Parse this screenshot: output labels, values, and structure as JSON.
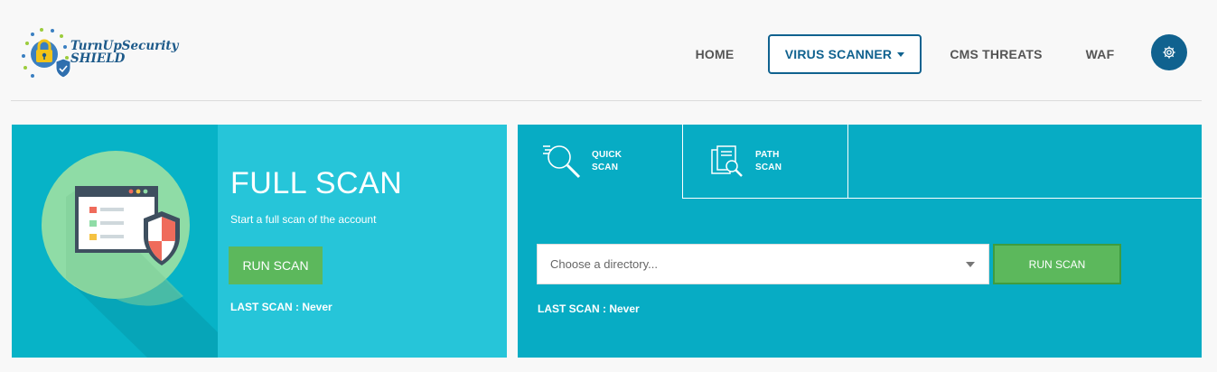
{
  "brand": {
    "line1": "TurnUpSecurity",
    "line2": "SHIELD"
  },
  "nav": {
    "home": "HOME",
    "virus_scanner": "VIRUS SCANNER",
    "cms_threats": "CMS THREATS",
    "waf": "WAF",
    "settings_icon": "gear-icon"
  },
  "full_scan": {
    "title": "FULL SCAN",
    "subtitle": "Start a full scan of the account",
    "run_label": "RUN SCAN",
    "last_scan": "LAST SCAN : Never"
  },
  "path_scanner": {
    "tabs": [
      {
        "line1": "QUICK",
        "line2": "SCAN",
        "icon": "search-lines-icon",
        "active": true
      },
      {
        "line1": "PATH",
        "line2": "SCAN",
        "icon": "documents-search-icon",
        "active": false
      }
    ],
    "directory_placeholder": "Choose a directory...",
    "run_label": "RUN SCAN",
    "last_scan": "LAST SCAN : Never"
  },
  "colors": {
    "primary": "#10628f",
    "teal_dark": "#07b3c7",
    "teal_light": "#26c5d9",
    "panel_teal": "#07acc4",
    "button_green": "#5cb85c"
  }
}
